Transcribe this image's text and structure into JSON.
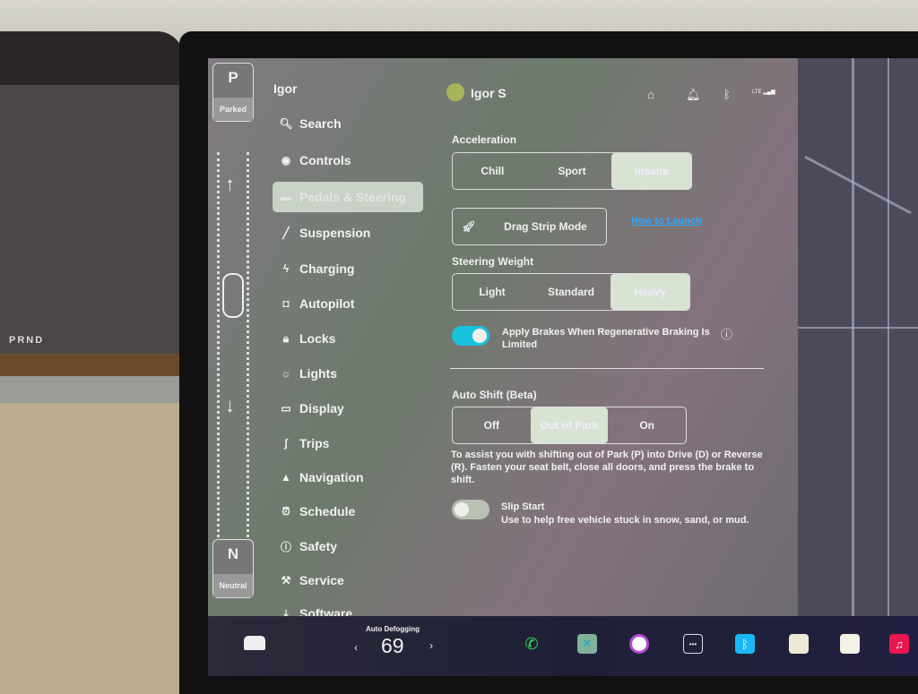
{
  "cluster": {
    "gear_text": "PRND"
  },
  "gear_selector": {
    "top_gear": "P",
    "top_status": "Parked",
    "bottom_gear": "N",
    "bottom_status": "Neutral"
  },
  "header": {
    "left_name": "Igor",
    "profile_name": "Igor S",
    "status_icons": [
      "garage-icon",
      "bell-icon",
      "bluetooth-icon",
      "lte-signal-icon"
    ],
    "lte": "LTE"
  },
  "sidebar": {
    "items": [
      {
        "label": "Search",
        "icon": "search-icon"
      },
      {
        "label": "Controls",
        "icon": "toggle-icon"
      },
      {
        "label": "Pedals & Steering",
        "icon": "car-icon",
        "selected": true
      },
      {
        "label": "Suspension",
        "icon": "wrench-icon"
      },
      {
        "label": "Charging",
        "icon": "bolt-icon"
      },
      {
        "label": "Autopilot",
        "icon": "steering-icon"
      },
      {
        "label": "Locks",
        "icon": "lock-icon"
      },
      {
        "label": "Lights",
        "icon": "sun-icon"
      },
      {
        "label": "Display",
        "icon": "display-icon"
      },
      {
        "label": "Trips",
        "icon": "trips-icon"
      },
      {
        "label": "Navigation",
        "icon": "navigation-icon"
      },
      {
        "label": "Schedule",
        "icon": "clock-icon"
      },
      {
        "label": "Safety",
        "icon": "safety-icon"
      },
      {
        "label": "Service",
        "icon": "wrench-icon"
      },
      {
        "label": "Software",
        "icon": "download-icon"
      }
    ]
  },
  "settings": {
    "acceleration": {
      "label": "Acceleration",
      "options": [
        "Chill",
        "Sport",
        "Insane"
      ],
      "selected": "Insane"
    },
    "drag_strip": {
      "label": "Drag Strip Mode",
      "link": "How to Launch"
    },
    "steering_weight": {
      "label": "Steering Weight",
      "options": [
        "Light",
        "Standard",
        "Heavy"
      ],
      "selected": "Heavy"
    },
    "apply_brakes": {
      "label": "Apply Brakes When Regenerative Braking Is Limited",
      "enabled": true
    },
    "auto_shift": {
      "label": "Auto Shift (Beta)",
      "options": [
        "Off",
        "Out of Park",
        "On"
      ],
      "selected": "Out of Park",
      "description": "To assist you with shifting out of Park (P) into Drive (D) or Reverse (R). Fasten your seat belt, close all doors, and press the brake to shift."
    },
    "slip_start": {
      "label": "Slip Start",
      "description": "Use to help free vehicle stuck in snow, sand, or mud.",
      "enabled": false
    }
  },
  "dock": {
    "climate_label": "Auto Defogging",
    "temperature": "69",
    "apps": [
      "phone-icon",
      "app-icon",
      "camera-icon",
      "dashcam-icon",
      "bluetooth-icon",
      "calendar-icon",
      "notes-icon",
      "music-icon"
    ]
  },
  "colors": {
    "accent": "#19c3e0",
    "link": "#2aa8ff",
    "phone": "#2ee05a",
    "music": "#e8174f",
    "bluetooth": "#1ab8f5"
  }
}
